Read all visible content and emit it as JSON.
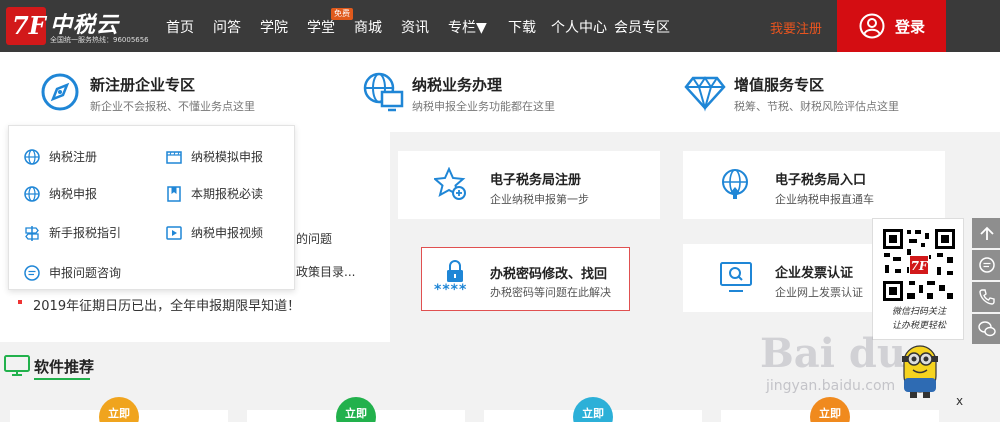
{
  "header": {
    "logo_mark": "7F",
    "logo_name": "中税云",
    "logo_sub": "全国统一服务热线：96005656",
    "nav": [
      {
        "label": "首页"
      },
      {
        "label": "问答"
      },
      {
        "label": "学院"
      },
      {
        "label": "学堂"
      },
      {
        "label": "商城"
      },
      {
        "label": "资讯"
      },
      {
        "label": "专栏▼"
      },
      {
        "label": "下载"
      },
      {
        "label": "个人中心"
      },
      {
        "label": "会员专区"
      }
    ],
    "badge": "免费",
    "register": "我要注册",
    "login": "登录"
  },
  "zones": [
    {
      "title": "新注册企业专区",
      "desc": "新企业不会报税、不懂业务点这里",
      "icon": "compass-icon"
    },
    {
      "title": "纳税业务办理",
      "desc": "纳税申报全业务功能都在这里",
      "icon": "globe-monitor-icon"
    },
    {
      "title": "增值服务专区",
      "desc": "税筹、节税、财税风险评估点这里",
      "icon": "diamond-icon"
    }
  ],
  "dropdown": [
    {
      "label": "纳税注册",
      "icon": "globe-icon"
    },
    {
      "label": "纳税模拟申报",
      "icon": "film-icon"
    },
    {
      "label": "纳税申报",
      "icon": "globe-icon"
    },
    {
      "label": "本期报税必读",
      "icon": "book-icon"
    },
    {
      "label": "新手报税指引",
      "icon": "signpost-icon"
    },
    {
      "label": "纳税申报视频",
      "icon": "play-icon"
    },
    {
      "label": "申报问题咨询",
      "icon": "chat-icon"
    }
  ],
  "peek": [
    "的问题",
    "政策目录..."
  ],
  "notice": "2019年征期日历已出，全年申报期限早知道！",
  "cards": [
    {
      "title": "电子税务局注册",
      "desc": "企业纳税申报第一步",
      "icon": "star-add-icon"
    },
    {
      "title": "电子税务局入口",
      "desc": "企业纳税申报直通车",
      "icon": "globe-upload-icon"
    },
    {
      "title": "办税密码修改、找回",
      "desc": "办税密码等问题在此解决",
      "icon": "lock-icon",
      "stars": "****"
    },
    {
      "title": "企业发票认证",
      "desc": "企业网上发票认证",
      "icon": "monitor-search-icon"
    }
  ],
  "qr": {
    "caption_1": "微信扫码关注",
    "caption_2": "让办税更轻松"
  },
  "software": {
    "title": "软件推荐",
    "badge": "立即"
  },
  "watermark": {
    "main": "Bai du",
    "sub": "jingyan.baidu.com"
  },
  "close": "x",
  "colors": {
    "nav_bg": "#3a3a3a",
    "login_red": "#d40d12",
    "accent_blue": "#1f86d6",
    "green": "#22b14c"
  }
}
